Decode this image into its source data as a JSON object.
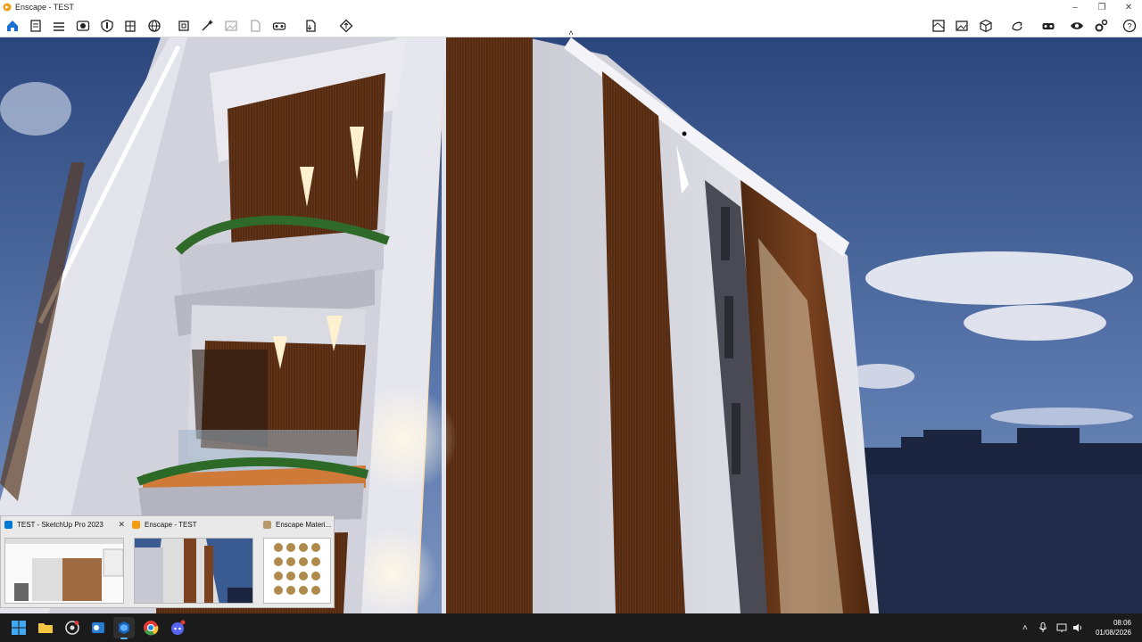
{
  "window": {
    "title": "Enscape - TEST",
    "controls": {
      "minimize": "–",
      "restore": "❐",
      "close": "✕"
    }
  },
  "toolbar": {
    "left_icons": [
      "home-icon",
      "list-icon",
      "layers-icon",
      "render-icon",
      "shield-icon",
      "building-icon",
      "globe-icon",
      "crop-icon",
      "magic-wand-icon",
      "image-icon",
      "document-icon",
      "vr-icon",
      "export-icon",
      "upload-icon"
    ],
    "right_icons": [
      "map-icon",
      "gallery-icon",
      "cube-icon",
      "sync-icon",
      "headset-icon",
      "eye-icon",
      "settings-icon",
      "help-icon"
    ],
    "collapse_glyph": "˄"
  },
  "taskbar_preview": {
    "items": [
      {
        "title": "TEST - SketchUp Pro 2023",
        "close": "✕"
      },
      {
        "title": "Enscape - TEST"
      },
      {
        "title": "Enscape Materi..."
      }
    ]
  },
  "taskbar": {
    "apps": [
      "windows-start-icon",
      "file-explorer-icon",
      "chrome-alt-icon",
      "outlook-icon",
      "sketchup-icon",
      "chrome-icon",
      "discord-icon"
    ],
    "tray_glyph": "˄",
    "time": "08:06",
    "date": "01/08/2026"
  },
  "colors": {
    "accent": "#0078d4",
    "enscape_orange": "#f39c12",
    "sky_top": "#2c4a82",
    "facade_white": "#dedee6",
    "wood": "#6b3a1c"
  }
}
